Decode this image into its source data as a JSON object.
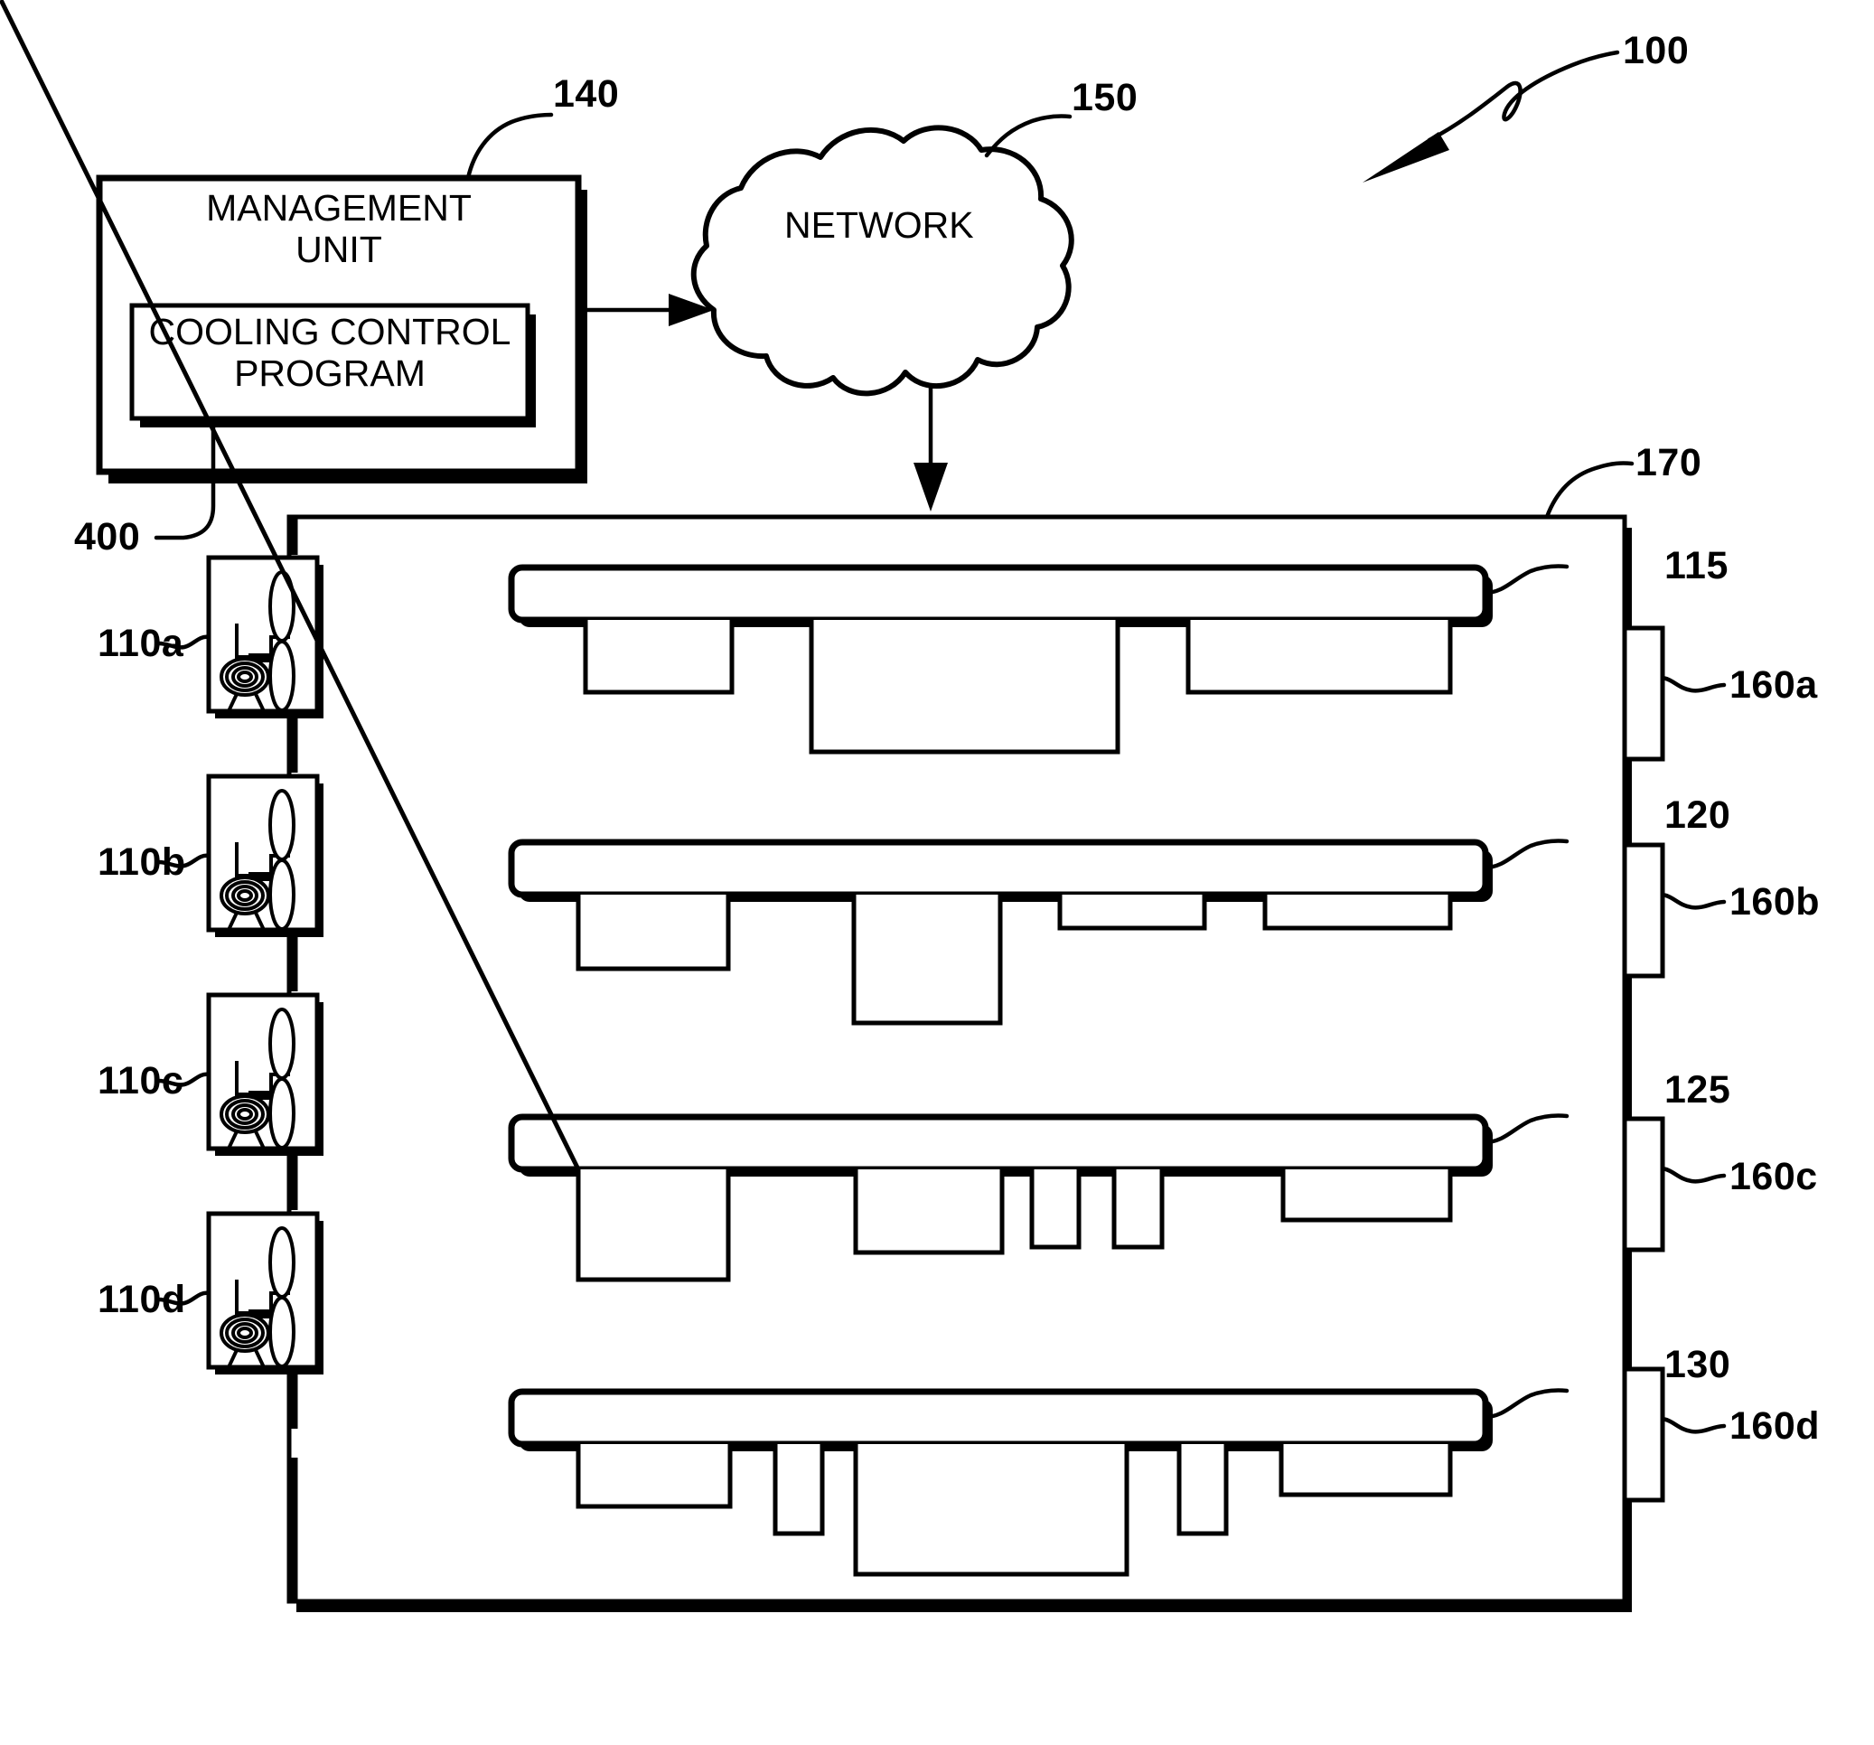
{
  "figure": {
    "id": "100",
    "title": "Cooling control system block diagram"
  },
  "management_unit": {
    "ref": "140",
    "label": "MANAGEMENT\nUNIT",
    "program": {
      "ref": "400",
      "label": "COOLING CONTROL\nPROGRAM"
    }
  },
  "network": {
    "ref": "150",
    "label": "NETWORK"
  },
  "enclosure": {
    "ref": "170"
  },
  "fans": [
    {
      "ref": "110a",
      "name": "fan-module-a"
    },
    {
      "ref": "110b",
      "name": "fan-module-b"
    },
    {
      "ref": "110c",
      "name": "fan-module-c"
    },
    {
      "ref": "110d",
      "name": "fan-module-d"
    }
  ],
  "servers": [
    {
      "ref": "115",
      "name": "server-board-115"
    },
    {
      "ref": "120",
      "name": "server-board-120"
    },
    {
      "ref": "125",
      "name": "server-board-125"
    },
    {
      "ref": "130",
      "name": "server-board-130"
    }
  ],
  "sensors": [
    {
      "ref": "160a",
      "name": "sensor-a"
    },
    {
      "ref": "160b",
      "name": "sensor-b"
    },
    {
      "ref": "160c",
      "name": "sensor-c"
    },
    {
      "ref": "160d",
      "name": "sensor-d"
    }
  ],
  "colors": {
    "line": "#000000",
    "background": "#ffffff"
  }
}
